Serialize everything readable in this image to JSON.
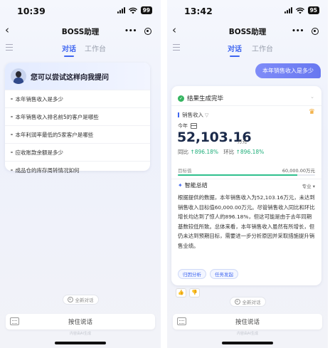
{
  "left_phone": {
    "status": {
      "time": "10:39",
      "battery": "99"
    },
    "nav": {
      "back": "‹",
      "title": "BOSS助理",
      "more": "•••"
    },
    "tabs": {
      "active": "对话",
      "inactive": "工作台"
    },
    "suggest": {
      "title": "您可以尝试这样向我提问",
      "items": [
        {
          "label": "本年销售收入是多少"
        },
        {
          "label": "本年销售收入排名前5的客户是哪些"
        },
        {
          "label": "本年利润率最低的5家客户是哪些"
        },
        {
          "label": "应收账款余额是多少"
        },
        {
          "label": "成品仓的库存周转情况如何"
        }
      ]
    },
    "new_chat": "全新对话",
    "input": {
      "hold_to_talk": "按住说话",
      "ai_note": "内容由AI生成"
    }
  },
  "right_phone": {
    "status": {
      "time": "13:42",
      "battery": "95"
    },
    "nav": {
      "back": "‹",
      "title": "BOSS助理",
      "more": "•••"
    },
    "tabs": {
      "active": "对话",
      "inactive": "工作台"
    },
    "user_message": "本年销售收入是多少",
    "result": {
      "status": "结果生成完毕",
      "metric": "销售收入",
      "period": "今年",
      "value": "52,103.16",
      "unit": "万元",
      "yoy_label": "同比",
      "yoy_value": "896.18%",
      "mom_label": "环比",
      "mom_value": "896.18%",
      "target_label": "目标值",
      "target_value": "60,000.00万元",
      "progress_fraction": 0.868,
      "summary_title": "智能总结",
      "summary_mode": "专业",
      "summary_text": "根据提供的数据，本年销售收入为52,103.16万元，未达到销售收入目标值60,000.00万元。尽管销售收入同比和环比增长均达到了惊人的896.18%，但这可能是由于去年同期基数较低所致。总体来看，本年销售收入虽然有所增长，但仍未达到预期目标，需要进一步分析原因并采取措施提升销售业绩。",
      "actions": [
        {
          "label": "归因分析"
        },
        {
          "label": "任务发起"
        }
      ]
    },
    "new_chat": "全新对话",
    "input": {
      "hold_to_talk": "按住说话",
      "ai_note": "内容由AI生成"
    }
  },
  "colors": {
    "accent": "#3f66f0",
    "positive": "#1fae7a",
    "progress": "#2fbf8e",
    "bubble": "#7080f2"
  }
}
